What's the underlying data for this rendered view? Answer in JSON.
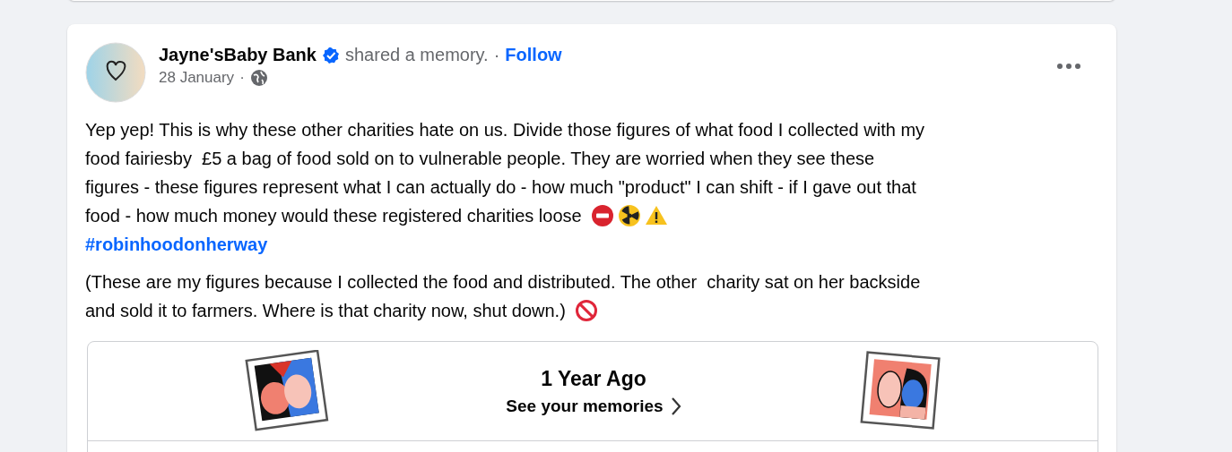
{
  "post": {
    "author": "Jayne'sBaby Bank",
    "verified": true,
    "action": "shared a memory.",
    "separator": "·",
    "follow": "Follow",
    "date": "28 January",
    "date_separator": "·",
    "paragraphs": [
      {
        "lines": [
          {
            "text": "Yep yep! This is why these other charities hate on us. Divide those figures of what food I collected with my"
          },
          {
            "text": "food fairiesby  £5 a bag of food sold on to vulnerable people. They are worried when they see these"
          },
          {
            "text": "figures - these figures represent what I can actually do - how much \"product\" I can shift - if I gave out that"
          },
          {
            "text": "food - how much money would these registered charities loose",
            "emojis": [
              {
                "kind": "no-entry"
              },
              {
                "kind": "radioactive"
              },
              {
                "kind": "warning"
              }
            ]
          }
        ],
        "hashtag": "#robinhoodonherway"
      },
      {
        "lines": [
          {
            "text": "(These are my figures because I collected the food and distributed. The other  charity sat on her backside"
          },
          {
            "text": "and sold it to farmers. Where is that charity now, shut down.)",
            "emojis": [
              {
                "kind": "prohibited"
              }
            ]
          }
        ]
      }
    ],
    "memory": {
      "title": "1 Year Ago",
      "link": "See your memories"
    }
  }
}
